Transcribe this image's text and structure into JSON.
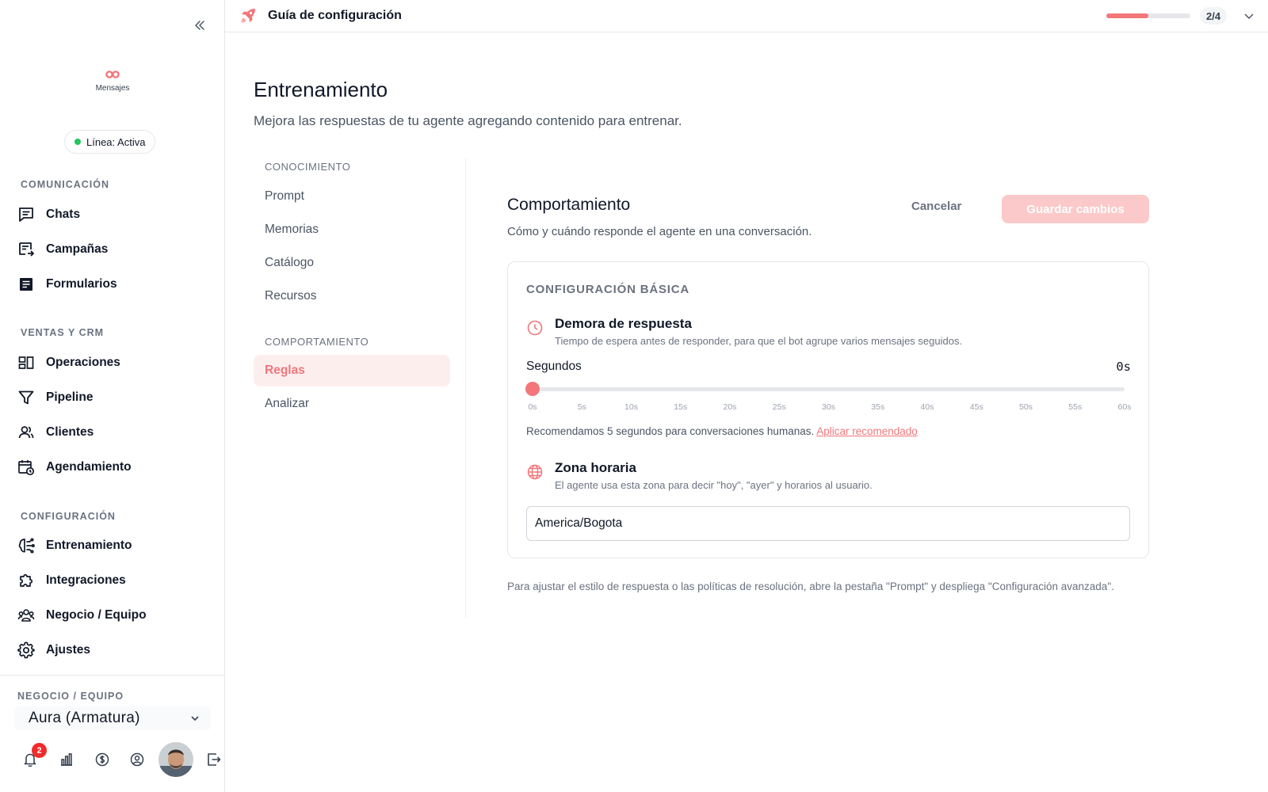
{
  "sidebar": {
    "brand_name": "Mensajes",
    "status": "Línea: Activa",
    "sections": [
      {
        "label": "COMUNICACIÓN"
      },
      {
        "label": "VENTAS Y CRM"
      },
      {
        "label": "CONFIGURACIÓN"
      }
    ],
    "items": [
      {
        "label": "Chats",
        "icon": "chat-icon"
      },
      {
        "label": "Campañas",
        "icon": "campaign-icon"
      },
      {
        "label": "Formularios",
        "icon": "form-icon"
      },
      {
        "label": "Operaciones",
        "icon": "operations-icon"
      },
      {
        "label": "Pipeline",
        "icon": "funnel-icon"
      },
      {
        "label": "Clientes",
        "icon": "users-icon"
      },
      {
        "label": "Agendamiento",
        "icon": "calendar-icon"
      },
      {
        "label": "Entrenamiento",
        "icon": "brain-icon"
      },
      {
        "label": "Integraciones",
        "icon": "puzzle-icon"
      },
      {
        "label": "Negocio / Equipo",
        "icon": "team-icon"
      },
      {
        "label": "Ajustes",
        "icon": "gear-icon"
      }
    ],
    "team_label": "NEGOCIO / EQUIPO",
    "team_value": "Aura (Armatura)",
    "notification_count": "2"
  },
  "topbar": {
    "title": "Guía de configuración",
    "progress_fraction": 0.5,
    "step": "2/4"
  },
  "page": {
    "title": "Entrenamiento",
    "subtitle": "Mejora las respuestas de tu agente agregando contenido para entrenar."
  },
  "subnav": {
    "sections": [
      {
        "label": "CONOCIMIENTO"
      },
      {
        "label": "COMPORTAMIENTO"
      }
    ],
    "items": [
      {
        "label": "Prompt"
      },
      {
        "label": "Memorias"
      },
      {
        "label": "Catálogo"
      },
      {
        "label": "Recursos"
      },
      {
        "label": "Reglas"
      },
      {
        "label": "Analizar"
      }
    ],
    "active": "Reglas"
  },
  "behavior": {
    "title": "Comportamiento",
    "subtitle": "Cómo y cuándo responde el agente en una conversación.",
    "cancel_label": "Cancelar",
    "save_label": "Guardar cambios",
    "card_section": "CONFIGURACIÓN BÁSICA",
    "delay": {
      "title": "Demora de respuesta",
      "description": "Tiempo de espera antes de responder, para que el bot agrupe varios mensajes seguidos.",
      "slider_label": "Segundos",
      "value_text": "0s",
      "value": 0,
      "min": 0,
      "max": 60,
      "ticks": [
        "0s",
        "5s",
        "10s",
        "15s",
        "20s",
        "25s",
        "30s",
        "35s",
        "40s",
        "45s",
        "50s",
        "55s",
        "60s"
      ],
      "recommendation": "Recomendamos 5 segundos para conversaciones humanas.",
      "apply_label": "Aplicar recomendado"
    },
    "timezone": {
      "title": "Zona horaria",
      "description": "El agente usa esta zona para decir \"hoy\", \"ayer\" y horarios al usuario.",
      "value": "America/Bogota"
    },
    "footnote": "Para ajustar el estilo de respuesta o las políticas de resolución, abre la pestaña \"Prompt\" y despliega \"Configuración avanzada\"."
  },
  "colors": {
    "accent": "#f2767a",
    "accent_soft": "#fdeeee",
    "status_active": "#22c55e",
    "badge": "#ef2b2b"
  }
}
